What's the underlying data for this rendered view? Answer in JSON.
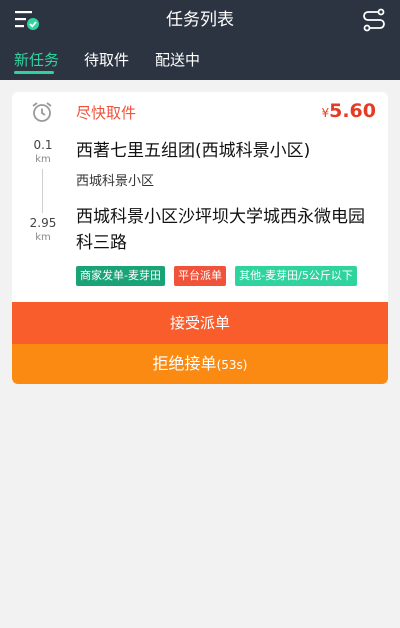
{
  "header": {
    "title": "任务列表",
    "menu_icon": "menu-check-icon",
    "route_icon": "route-icon"
  },
  "tabs": [
    {
      "label": "新任务",
      "active": true
    },
    {
      "label": "待取件",
      "active": false
    },
    {
      "label": "配送中",
      "active": false
    }
  ],
  "order": {
    "pickup_label": "尽快取件",
    "price_currency": "¥",
    "price_amount": "5.60",
    "pickup_distance": {
      "value": "0.1",
      "unit": "km"
    },
    "pickup_address": "西著七里五组团(西城科景小区)",
    "pickup_sub": "西城科景小区",
    "delivery_distance": {
      "value": "2.95",
      "unit": "km"
    },
    "delivery_address": "西城科景小区沙坪坝大学城西永微电园科三路",
    "tags": [
      {
        "label": "商家发单-麦芽田",
        "color": "#1aa376"
      },
      {
        "label": "平台派单",
        "color": "#f0533a"
      },
      {
        "label": "其他-麦芽田/5公斤以下",
        "color": "#2fd39d"
      }
    ],
    "accept_label": "接受派单",
    "reject_label": "拒绝接单",
    "reject_countdown": "(53s)"
  },
  "colors": {
    "header_bg": "#2b3440",
    "accent": "#2fd39d",
    "accept": "#fa5d2c",
    "reject": "#fb8a13"
  }
}
